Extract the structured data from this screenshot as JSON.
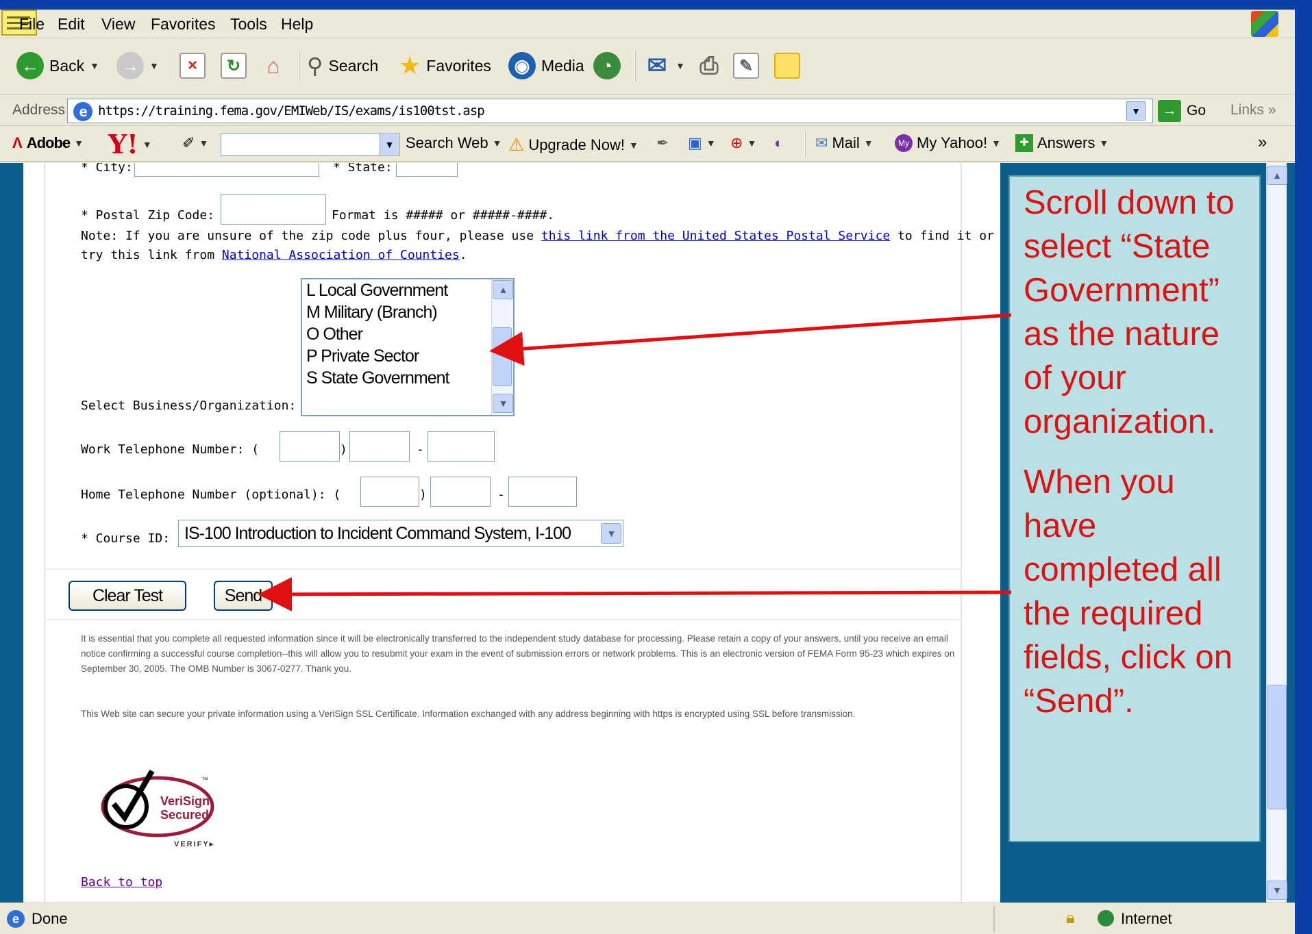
{
  "menu": {
    "items": [
      "File",
      "Edit",
      "View",
      "Favorites",
      "Tools",
      "Help"
    ]
  },
  "toolbar": {
    "back_label": "Back",
    "search_label": "Search",
    "favorites_label": "Favorites",
    "media_label": "Media"
  },
  "address": {
    "label": "Address",
    "url": "https://training.fema.gov/EMIWeb/IS/exams/is100tst.asp",
    "go_label": "Go",
    "links_label": "Links"
  },
  "ybar": {
    "adobe_label": "Adobe",
    "search_web_label": "Search Web",
    "upgrade_label": "Upgrade Now!",
    "mail_label": "Mail",
    "my_yahoo_label": "My Yahoo!",
    "answers_label": "Answers"
  },
  "form": {
    "city_label": "* City:",
    "state_label": "* State:",
    "zip_label": "* Postal Zip Code:",
    "zip_format": "Format is #####  or #####-####.",
    "note_prefix": "Note: If you are unsure of the zip code plus four, please use ",
    "note_link1": "this link from the United States Postal Service",
    "note_mid": " to find it or",
    "note_line2_prefix": "try this link from ",
    "note_link2": "National Association of Counties",
    "note_line2_suffix": ".",
    "org_label": "Select Business/Organization:",
    "org_options": [
      "L Local Government",
      "M Military (Branch)",
      "O Other",
      "P Private Sector",
      "S State Government"
    ],
    "work_phone_label": "Work Telephone Number: (",
    "home_phone_label": "Home Telephone Number (optional): (",
    "paren_close": ")",
    "dash": "-",
    "course_label": "* Course ID:",
    "course_value": "IS-100 Introduction to Incident Command System, I-100"
  },
  "buttons": {
    "clear_label": "Clear Test",
    "send_label": "Send"
  },
  "disclaimer": {
    "p1": "It is essential that you complete all requested information since it will be electronically transferred to the independent study database for processing. Please retain a copy of your answers, until you receive an email notice confirming a successful course completion--this will allow you to resubmit your exam in the event of submission errors or network problems. This is an electronic version of FEMA Form 95-23 which expires on September 30, 2005. The OMB Number is 3067-0277. Thank you.",
    "p2": "This Web site can secure your private information using a VeriSign SSL Certificate. Information exchanged with any address beginning with https is encrypted using SSL before transmission."
  },
  "verisign": {
    "line1": "VeriSign",
    "line2": "Secured",
    "verify": "VERIFY▸",
    "tm": "™"
  },
  "back_to_top": "Back to top",
  "annotation": {
    "para1": "Scroll down to select “State Government” as the nature of your organization.",
    "para2": "When you have completed all the required fields, click on “Send”."
  },
  "status": {
    "left": "Done",
    "zone": "Internet"
  },
  "colors": {
    "annotation_text": "#e01010",
    "annotation_bg": "#b9e1e5",
    "arrow": "#e01010",
    "page_bg": "#0d5c8e"
  }
}
